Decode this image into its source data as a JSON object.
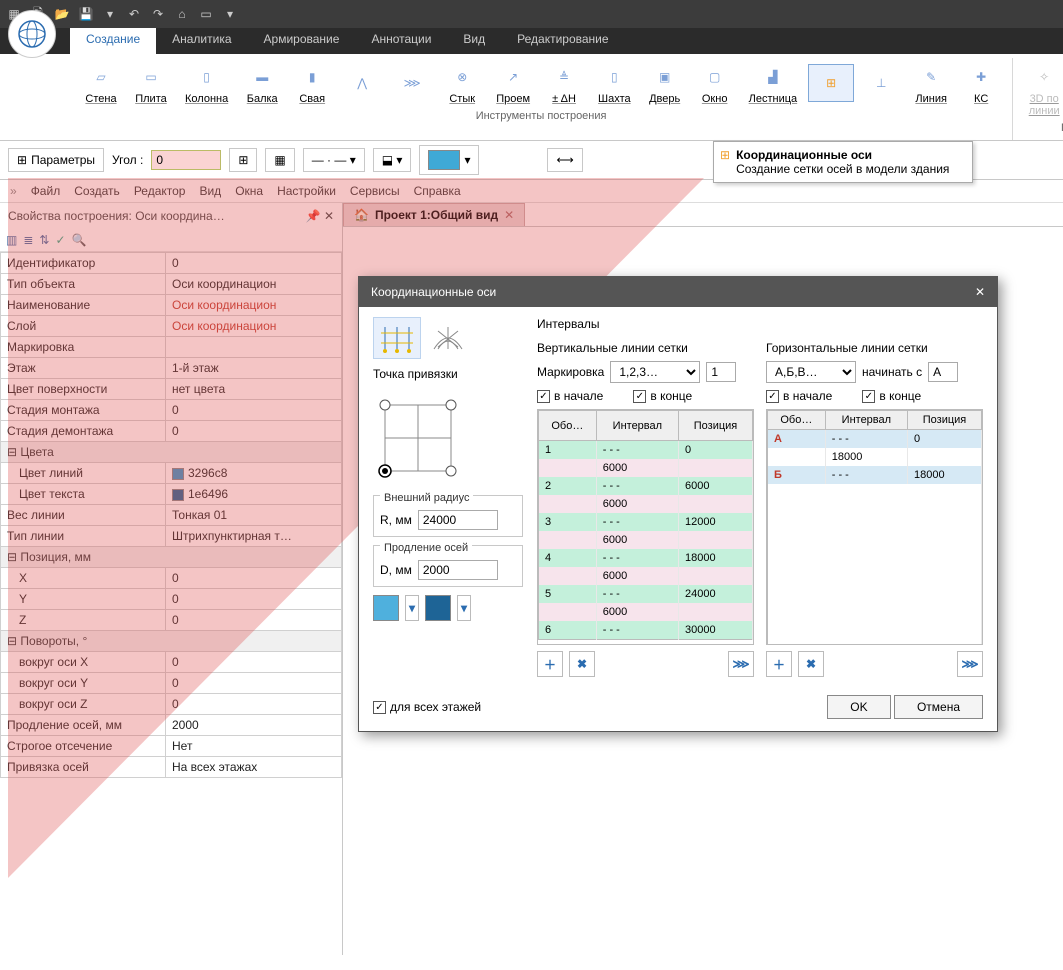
{
  "tabs": [
    "Создание",
    "Аналитика",
    "Армирование",
    "Аннотации",
    "Вид",
    "Редактирование"
  ],
  "ribbon": {
    "tools_title": "Инструменты построения",
    "surfaces_title": "Поверхности",
    "buttons": {
      "wall": "Стена",
      "slab": "Плита",
      "column": "Колонна",
      "beam": "Балка",
      "pile": "Свая",
      "joint": "Стык",
      "opening": "Проем",
      "dh": "± ΔH",
      "shaft": "Шахта",
      "door": "Дверь",
      "window": "Окно",
      "stair": "Лестница",
      "line": "Линия",
      "ks": "КС",
      "line3d": "3D по\nлинии"
    }
  },
  "toolbar2": {
    "params": "Параметры",
    "angle_label": "Угол :",
    "angle_value": "0"
  },
  "tooltip": {
    "title": "Координационные оси",
    "desc": "Создание сетки осей в модели здания"
  },
  "menu": [
    "Файл",
    "Создать",
    "Редактор",
    "Вид",
    "Окна",
    "Настройки",
    "Сервисы",
    "Справка"
  ],
  "props": {
    "header": "Свойства построения: Оси координа…",
    "rows": [
      {
        "k": "Идентификатор",
        "v": "0"
      },
      {
        "k": "Тип объекта",
        "v": "Оси координацион"
      },
      {
        "k": "Наименование",
        "v": "Оси координацион",
        "hl": true
      },
      {
        "k": "Слой",
        "v": "Оси координацион",
        "hl": true
      },
      {
        "k": "Маркировка",
        "v": ""
      },
      {
        "k": "Этаж",
        "v": "1-й этаж"
      },
      {
        "k": "Цвет поверхности",
        "v": "нет цвета"
      },
      {
        "k": "Стадия монтажа",
        "v": "0"
      },
      {
        "k": "Стадия демонтажа",
        "v": "0"
      }
    ],
    "colors_group": "Цвета",
    "color_line": {
      "k": "Цвет линий",
      "v": "3296c8",
      "c": "#3296c8"
    },
    "color_text": {
      "k": "Цвет текста",
      "v": "1e6496",
      "c": "#1e6496"
    },
    "weight": {
      "k": "Вес линии",
      "v": "Тонкая 01"
    },
    "ltype": {
      "k": "Тип линии",
      "v": "Штрихпунктирная т…"
    },
    "pos_group": "Позиция, мм",
    "pos": {
      "x": "0",
      "y": "0",
      "z": "0"
    },
    "rot_group": "Повороты, °",
    "rot": {
      "x": "0",
      "y": "0",
      "z": "0"
    },
    "ext": {
      "k": "Продление осей, мм",
      "v": "2000"
    },
    "cut": {
      "k": "Строгое отсечение",
      "v": "Нет"
    },
    "snap": {
      "k": "Привязка осей",
      "v": "На всех этажах"
    }
  },
  "doc_tab": "Проект 1:Общий вид",
  "dialog": {
    "title": "Координационные оси",
    "intervals": "Интервалы",
    "anchor": "Точка привязки",
    "outer_r": "Внешний радиус",
    "r_label": "R, мм",
    "r_val": "24000",
    "ext": "Продление осей",
    "d_label": "D, мм",
    "d_val": "2000",
    "all_floors": "для всех этажей",
    "vert": {
      "title": "Вертикальные линии сетки",
      "mark": "Маркировка",
      "sel": "1,2,3…",
      "start": "1",
      "begin": "в начале",
      "end": "в конце",
      "cols": [
        "Обо…",
        "Интервал",
        "Позиция"
      ],
      "rows": [
        [
          "1",
          "- - -",
          "0"
        ],
        [
          "",
          "6000",
          ""
        ],
        [
          "2",
          "- - -",
          "6000"
        ],
        [
          "",
          "6000",
          ""
        ],
        [
          "3",
          "- - -",
          "12000"
        ],
        [
          "",
          "6000",
          ""
        ],
        [
          "4",
          "- - -",
          "18000"
        ],
        [
          "",
          "6000",
          ""
        ],
        [
          "5",
          "- - -",
          "24000"
        ],
        [
          "",
          "6000",
          ""
        ],
        [
          "6",
          "- - -",
          "30000"
        ]
      ]
    },
    "horiz": {
      "title": "Горизонтальные линии сетки",
      "sel": "А,Б,В…",
      "start_label": "начинать с",
      "start": "А",
      "begin": "в начале",
      "end": "в конце",
      "cols": [
        "Обо…",
        "Интервал",
        "Позиция"
      ],
      "rows": [
        [
          "А",
          "- - -",
          "0"
        ],
        [
          "",
          "18000",
          ""
        ],
        [
          "Б",
          "- - -",
          "18000"
        ]
      ]
    },
    "ok": "OK",
    "cancel": "Отмена"
  }
}
